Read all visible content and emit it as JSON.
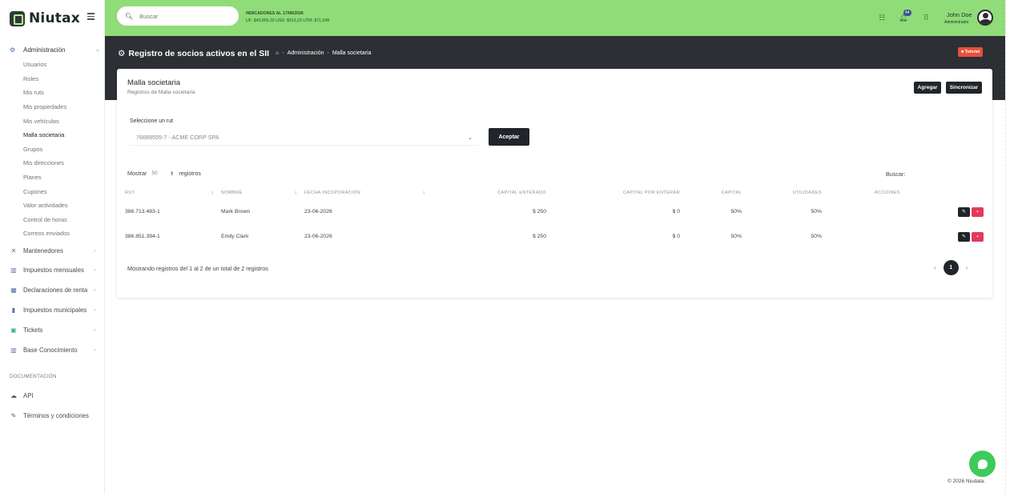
{
  "app": {
    "logo_text": "Niutax"
  },
  "sidebar": {
    "admin_label": "Administración",
    "admin_subitems": [
      "Usuarios",
      "Roles",
      "Mis ruts",
      "Mis propiedades",
      "Mis vehículos",
      "Malla societaria",
      "Grupos",
      "Mis direcciones",
      "Planes",
      "Cupones",
      "Valor actividades",
      "Control de horas",
      "Correos enviados"
    ],
    "items": [
      {
        "label": "Mantenedores",
        "icon": "tools-icon"
      },
      {
        "label": "Impuestos mensuales",
        "icon": "books-icon"
      },
      {
        "label": "Declaraciones de renta",
        "icon": "building-icon"
      },
      {
        "label": "Impuestos municipales",
        "icon": "chart-icon"
      },
      {
        "label": "Tickets",
        "icon": "ticket-icon"
      },
      {
        "label": "Base Conocimiento",
        "icon": "library-icon"
      }
    ],
    "doc_header": "DOCUMENTACIÓN",
    "doc_items": [
      {
        "label": "API",
        "icon": "cloud-icon"
      },
      {
        "label": "Términos y condiciones",
        "icon": "document-icon"
      }
    ]
  },
  "topbar": {
    "search_placeholder": "Buscar",
    "indicadores_title": "INDICADORES AL 17/08/2026",
    "indicadores_values": "UF: $40,855,33   USD: $913,15   UTM: $71,548",
    "notifications_count": "44",
    "user_name": "John Doe",
    "user_role": "Administrador"
  },
  "header": {
    "title": "Registro de socios activos en el SII",
    "breadcrumb": [
      "Administración",
      "Malla societaria"
    ],
    "tutorial_label": "Tutorial"
  },
  "card": {
    "title": "Malla societaria",
    "subtitle": "Registros de Malla societaria",
    "add_label": "Agregar",
    "sync_label": "Sincronizar",
    "select_label": "Seleccione un rut",
    "select_value": "76689555-7 - ACME CORP SPA",
    "accept_label": "Aceptar",
    "show_label": "Mostrar",
    "show_value": "50",
    "records_label": "registros",
    "search_label": "Buscar:",
    "columns": [
      "RUT",
      "NOMBRE",
      "FECHA INCOPORACIÓN",
      "CAPITAL ENTERADO",
      "CAPITAL POR ENTERAR",
      "CAPITAL",
      "UTILIDADES",
      "ACCIONES"
    ],
    "rows": [
      {
        "rut": "386.713.483-1",
        "nombre": "Mark Brown",
        "fecha": "23-06-2026",
        "enterado": "$ 250",
        "por_enterar": "$ 0",
        "capital": "50%",
        "utilidades": "50%"
      },
      {
        "rut": "386.851.394-1",
        "nombre": "Emily Clark",
        "fecha": "23-06-2026",
        "enterado": "$ 250",
        "por_enterar": "$ 0",
        "capital": "50%",
        "utilidades": "50%"
      }
    ],
    "footer_info": "Mostrando registros del 1 al 2 de un total de 2 registros",
    "current_page": "1"
  },
  "footer": {
    "copyright": "© 2026  Niudata."
  }
}
